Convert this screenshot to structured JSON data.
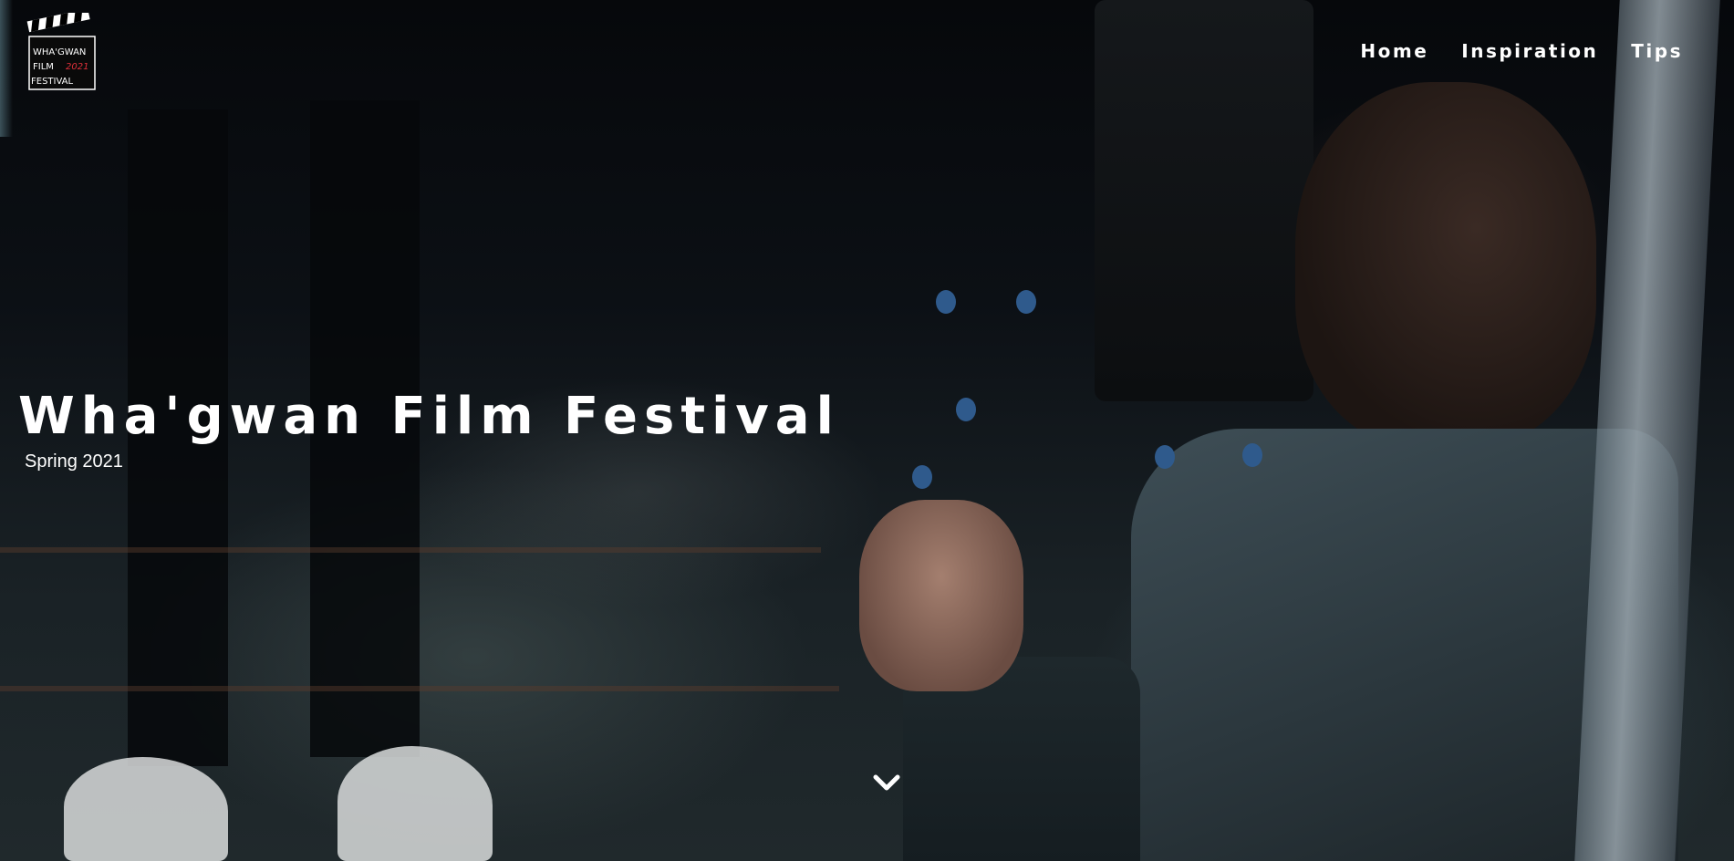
{
  "logo": {
    "line1": "WHA'GWAN",
    "line2_left": "FILM",
    "line2_right": "2021",
    "line3": "FESTIVAL",
    "accent_color": "#e0303a"
  },
  "nav": {
    "items": [
      {
        "label": "Home"
      },
      {
        "label": "Inspiration"
      },
      {
        "label": "Tips"
      }
    ]
  },
  "hero": {
    "title": "Wha'gwan Film Festival",
    "subtitle": "Spring 2021",
    "scroll_icon": "chevron-down-icon"
  }
}
